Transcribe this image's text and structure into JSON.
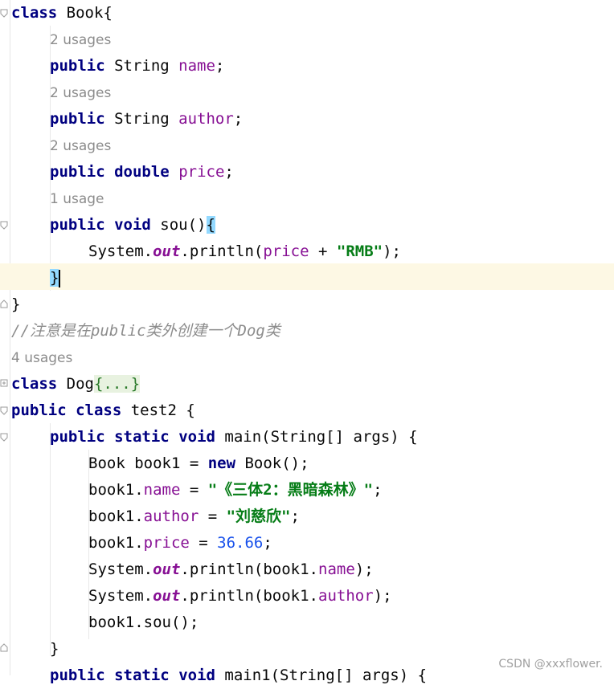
{
  "editor": {
    "line1": {
      "kw": "class",
      "name": " Book{"
    },
    "hint1": "2 usages",
    "line2": {
      "kw": "public",
      "type": " String ",
      "field": "name",
      "end": ";"
    },
    "hint2": "2 usages",
    "line3": {
      "kw": "public",
      "type": " String ",
      "field": "author",
      "end": ";"
    },
    "hint3": "2 usages",
    "line4": {
      "kw1": "public",
      "kw2": "double",
      "field": "price",
      "end": ";"
    },
    "hint4": "1 usage",
    "line5": {
      "kw1": "public",
      "kw2": "void",
      "name": " sou()",
      "brace": "{"
    },
    "line6": {
      "a": "System.",
      "out": "out",
      "b": ".println(",
      "field": "price",
      "c": " + ",
      "str": "\"RMB\"",
      "d": ");"
    },
    "line7": {
      "brace": "}"
    },
    "line8": {
      "text": "}"
    },
    "comment": "//注意是在public类外创建一个Dog类",
    "hint5": "4 usages",
    "line9": {
      "kw": "class",
      "name": " Dog",
      "folded": "{...}"
    },
    "line10": {
      "kw1": "public",
      "kw2": "class",
      "name": " test2 {"
    },
    "line11": {
      "kw1": "public",
      "kw2": "static",
      "kw3": "void",
      "name": " main(String[] args) {"
    },
    "line12": {
      "a": "Book book1 = ",
      "kw": "new",
      "b": " Book();"
    },
    "line13": {
      "a": "book1.",
      "field": "name",
      "b": " = ",
      "str": "\"《三体2：黑暗森林》\"",
      "c": ";"
    },
    "line14": {
      "a": "book1.",
      "field": "author",
      "b": " = ",
      "str": "\"刘慈欣\"",
      "c": ";"
    },
    "line15": {
      "a": "book1.",
      "field": "price",
      "b": " = ",
      "num": "36.66",
      "c": ";"
    },
    "line16": {
      "a": "System.",
      "out": "out",
      "b": ".println(book1.",
      "field": "name",
      "c": ");"
    },
    "line17": {
      "a": "System.",
      "out": "out",
      "b": ".println(book1.",
      "field": "author",
      "c": ");"
    },
    "line18": {
      "text": "book1.sou();"
    },
    "line19": {
      "text": "}"
    },
    "line20": {
      "kw1": "public",
      "kw2": "static",
      "kw3": "void",
      "name": " main1(String[] args) {"
    }
  },
  "watermark": "CSDN @xxxflower."
}
